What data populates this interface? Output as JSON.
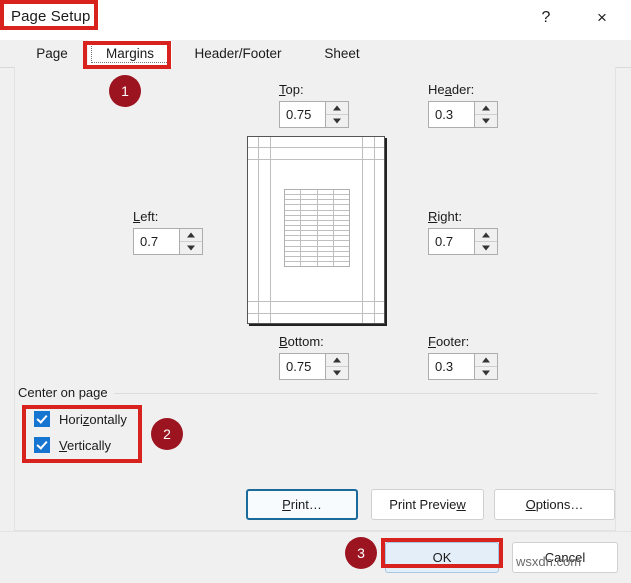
{
  "window": {
    "title": "Page Setup",
    "help_label": "?",
    "close_label": "×"
  },
  "tabs": [
    {
      "label": "Page",
      "selected": false
    },
    {
      "label": "Margins",
      "selected": true
    },
    {
      "label": "Header/Footer",
      "selected": false
    },
    {
      "label": "Sheet",
      "selected": false
    }
  ],
  "margins": {
    "top": {
      "label": "Top:",
      "accel": "T",
      "value": "0.75"
    },
    "header": {
      "label": "Header:",
      "accel": "a",
      "value": "0.3"
    },
    "left": {
      "label": "Left:",
      "accel": "L",
      "value": "0.7"
    },
    "right": {
      "label": "Right:",
      "accel": "R",
      "value": "0.7"
    },
    "bottom": {
      "label": "Bottom:",
      "accel": "B",
      "value": "0.75"
    },
    "footer": {
      "label": "Footer:",
      "accel": "F",
      "value": "0.3"
    }
  },
  "preview": {
    "grid_rows": 15,
    "grid_cols": 4
  },
  "center_on_page": {
    "group_label": "Center on page",
    "horizontally": {
      "label": "Horizontally",
      "accel": "z",
      "checked": true
    },
    "vertically": {
      "label": "Vertically",
      "accel": "V",
      "checked": true
    }
  },
  "buttons": {
    "print": {
      "label": "Print…",
      "accel": "P"
    },
    "print_preview": {
      "label": "Print Preview",
      "accel": "w"
    },
    "options": {
      "label": "Options…",
      "accel": "O"
    },
    "ok": {
      "label": "OK"
    },
    "cancel": {
      "label": "Cancel"
    }
  },
  "annotations": [
    {
      "id": "1",
      "target": "margins-tab"
    },
    {
      "id": "2",
      "target": "center-on-page-checkboxes"
    },
    {
      "id": "3",
      "target": "ok-button"
    }
  ],
  "watermark": "wsxdn.com",
  "colors": {
    "accent_checkbox": "#1675d1",
    "annotation_red": "#d8221e",
    "annotation_circle": "#9c1420",
    "default_button_fill": "#e3eef8",
    "focus_border": "#1b6a9c"
  }
}
